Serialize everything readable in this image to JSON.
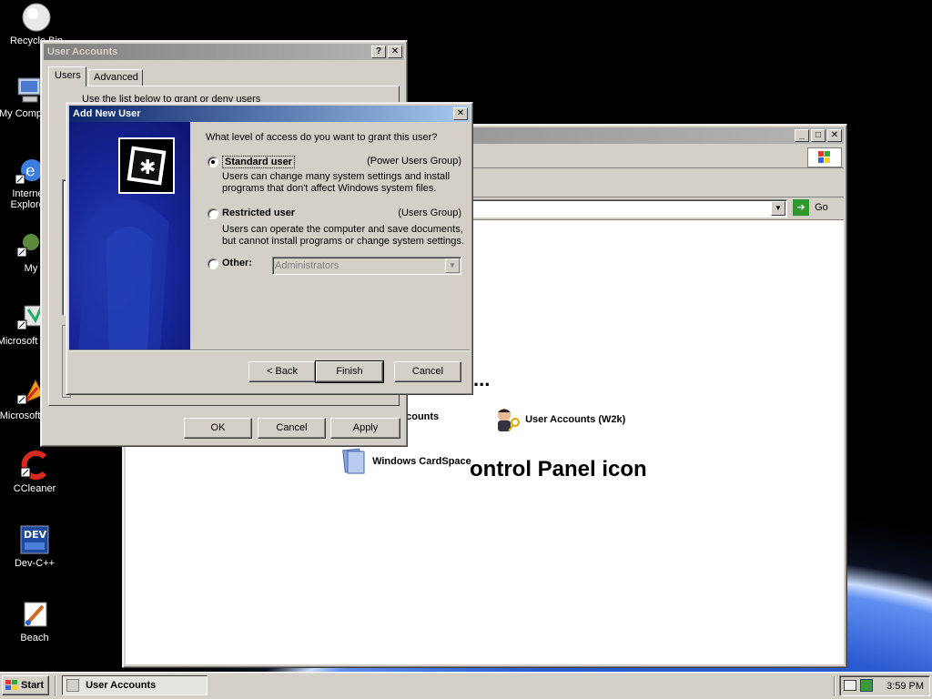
{
  "desktop": {
    "icons": [
      {
        "label": "Recycle Bin",
        "icon": "recycle-bin-icon"
      },
      {
        "label": "My Computer",
        "icon": "computer-icon"
      },
      {
        "label": "Internet Explorer",
        "icon": "internet-explorer-icon"
      },
      {
        "label": "My",
        "icon": "network-icon"
      },
      {
        "label": "Microsoft Basic",
        "icon": "vb-icon"
      },
      {
        "label": "Microsoft C++",
        "icon": "vc-icon"
      },
      {
        "label": "CCleaner",
        "icon": "ccleaner-icon"
      },
      {
        "label": "Dev-C++",
        "icon": "devcpp-icon"
      },
      {
        "label": "Beach",
        "icon": "paint-icon"
      }
    ]
  },
  "explorer": {
    "address_go": "Go",
    "heading_fragment_1": "...",
    "heading_fragment_2": "ontrol Panel icon",
    "items": [
      {
        "label": "ccounts",
        "icon": "user-accounts-icon"
      },
      {
        "label": "User Accounts (W2k)",
        "icon": "user-accounts-w2k-icon"
      },
      {
        "label": "Windows CardSpace",
        "icon": "cardspace-icon"
      }
    ]
  },
  "user_accounts": {
    "title": "User Accounts",
    "tabs": [
      {
        "label": "Users"
      },
      {
        "label": "Advanced"
      }
    ],
    "intro_fragment": "Use the list below to grant or deny users",
    "buttons": {
      "ok": "OK",
      "cancel": "Cancel",
      "apply": "Apply"
    }
  },
  "add_user": {
    "title": "Add New User",
    "question": "What level of access do you want to grant this user?",
    "options": [
      {
        "label": "Standard user",
        "group": "(Power Users Group)",
        "desc": "Users can change many system settings and install programs that don't affect Windows system files.",
        "selected": true
      },
      {
        "label": "Restricted user",
        "group": "(Users Group)",
        "desc": "Users can operate the computer and save documents, but cannot install programs or change system settings.",
        "selected": false
      },
      {
        "label": "Other:",
        "group": "",
        "desc": "",
        "selected": false
      }
    ],
    "other_select_value": "Administrators",
    "buttons": {
      "back": "< Back",
      "finish": "Finish",
      "cancel": "Cancel"
    }
  },
  "taskbar": {
    "start": "Start",
    "task": "User Accounts",
    "clock": "3:59 PM"
  }
}
